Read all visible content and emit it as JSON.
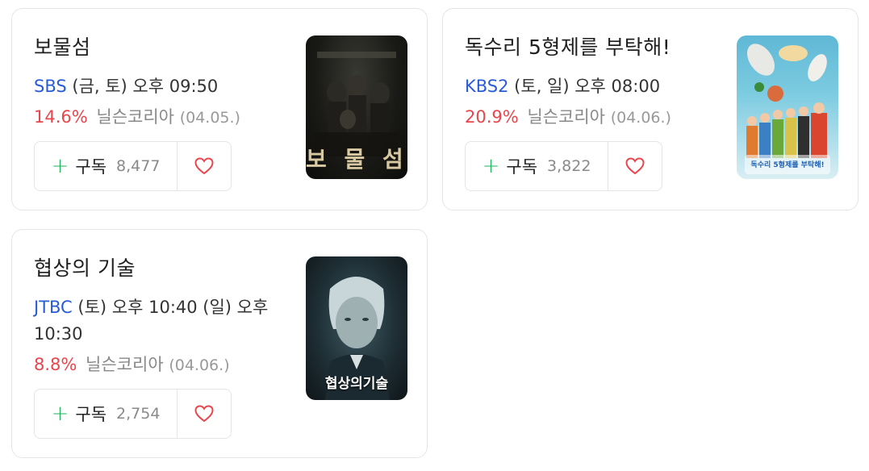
{
  "cards": [
    {
      "title": "보물섬",
      "channel": "SBS",
      "schedule": " (금, 토) 오후 09:50",
      "rating_pct": "14.6%",
      "rating_source": "닐슨코리아",
      "rating_date": "(04.05.)",
      "subscribe_label": "구독",
      "subscribe_count": "8,477",
      "poster_title": "보 물 섬"
    },
    {
      "title": "독수리 5형제를 부탁해!",
      "channel": "KBS2",
      "schedule": " (토, 일) 오후 08:00",
      "rating_pct": "20.9%",
      "rating_source": "닐슨코리아",
      "rating_date": "(04.06.)",
      "subscribe_label": "구독",
      "subscribe_count": "3,822",
      "poster_title": "독수리 5형제를 부탁해!"
    },
    {
      "title": "협상의 기술",
      "channel": "JTBC",
      "schedule": " (토) 오후 10:40 (일) 오후 10:30",
      "rating_pct": "8.8%",
      "rating_source": "닐슨코리아",
      "rating_date": "(04.06.)",
      "subscribe_label": "구독",
      "subscribe_count": "2,754",
      "poster_title": "협상의기술"
    }
  ],
  "colors": {
    "channel": "#2a5bd7",
    "rating": "#e8464c",
    "plus": "#19b35a",
    "heart": "#e8464c"
  }
}
